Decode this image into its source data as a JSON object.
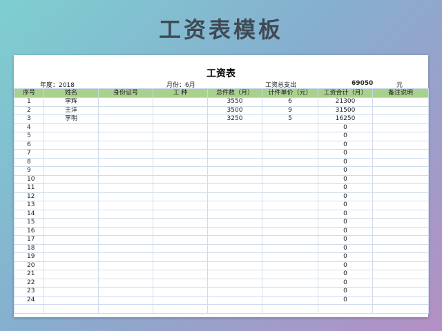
{
  "banner": {
    "title": "工资表模板"
  },
  "sheet": {
    "title": "工资表",
    "year_label": "年度：2018",
    "month_label": "月份：6月",
    "total_label": "工资总支出",
    "total_value": "69050",
    "currency": "元"
  },
  "table": {
    "headers": [
      "序号",
      "姓名",
      "身份证号",
      "工  种",
      "总件数（月）",
      "计件单价（元）",
      "工资合计（月）",
      "备注说明"
    ],
    "rows": [
      [
        "1",
        "李辉",
        "",
        "",
        "3550",
        "6",
        "21300",
        ""
      ],
      [
        "2",
        "王洋",
        "",
        "",
        "3500",
        "9",
        "31500",
        ""
      ],
      [
        "3",
        "李明",
        "",
        "",
        "3250",
        "5",
        "16250",
        ""
      ],
      [
        "4",
        "",
        "",
        "",
        "",
        "",
        "0",
        ""
      ],
      [
        "5",
        "",
        "",
        "",
        "",
        "",
        "0",
        ""
      ],
      [
        "6",
        "",
        "",
        "",
        "",
        "",
        "0",
        ""
      ],
      [
        "7",
        "",
        "",
        "",
        "",
        "",
        "0",
        ""
      ],
      [
        "8",
        "",
        "",
        "",
        "",
        "",
        "0",
        ""
      ],
      [
        "9",
        "",
        "",
        "",
        "",
        "",
        "0",
        ""
      ],
      [
        "10",
        "",
        "",
        "",
        "",
        "",
        "0",
        ""
      ],
      [
        "11",
        "",
        "",
        "",
        "",
        "",
        "0",
        ""
      ],
      [
        "12",
        "",
        "",
        "",
        "",
        "",
        "0",
        ""
      ],
      [
        "13",
        "",
        "",
        "",
        "",
        "",
        "0",
        ""
      ],
      [
        "14",
        "",
        "",
        "",
        "",
        "",
        "0",
        ""
      ],
      [
        "15",
        "",
        "",
        "",
        "",
        "",
        "0",
        ""
      ],
      [
        "16",
        "",
        "",
        "",
        "",
        "",
        "0",
        ""
      ],
      [
        "17",
        "",
        "",
        "",
        "",
        "",
        "0",
        ""
      ],
      [
        "18",
        "",
        "",
        "",
        "",
        "",
        "0",
        ""
      ],
      [
        "19",
        "",
        "",
        "",
        "",
        "",
        "0",
        ""
      ],
      [
        "20",
        "",
        "",
        "",
        "",
        "",
        "0",
        ""
      ],
      [
        "21",
        "",
        "",
        "",
        "",
        "",
        "0",
        ""
      ],
      [
        "22",
        "",
        "",
        "",
        "",
        "",
        "0",
        ""
      ],
      [
        "23",
        "",
        "",
        "",
        "",
        "",
        "0",
        ""
      ],
      [
        "24",
        "",
        "",
        "",
        "",
        "",
        "0",
        ""
      ],
      [
        "",
        "",
        "",
        "",
        "",
        "",
        "",
        ""
      ]
    ]
  },
  "colors": {
    "header_fill": "#a9d18e",
    "grid_line": "#cfdcec"
  }
}
